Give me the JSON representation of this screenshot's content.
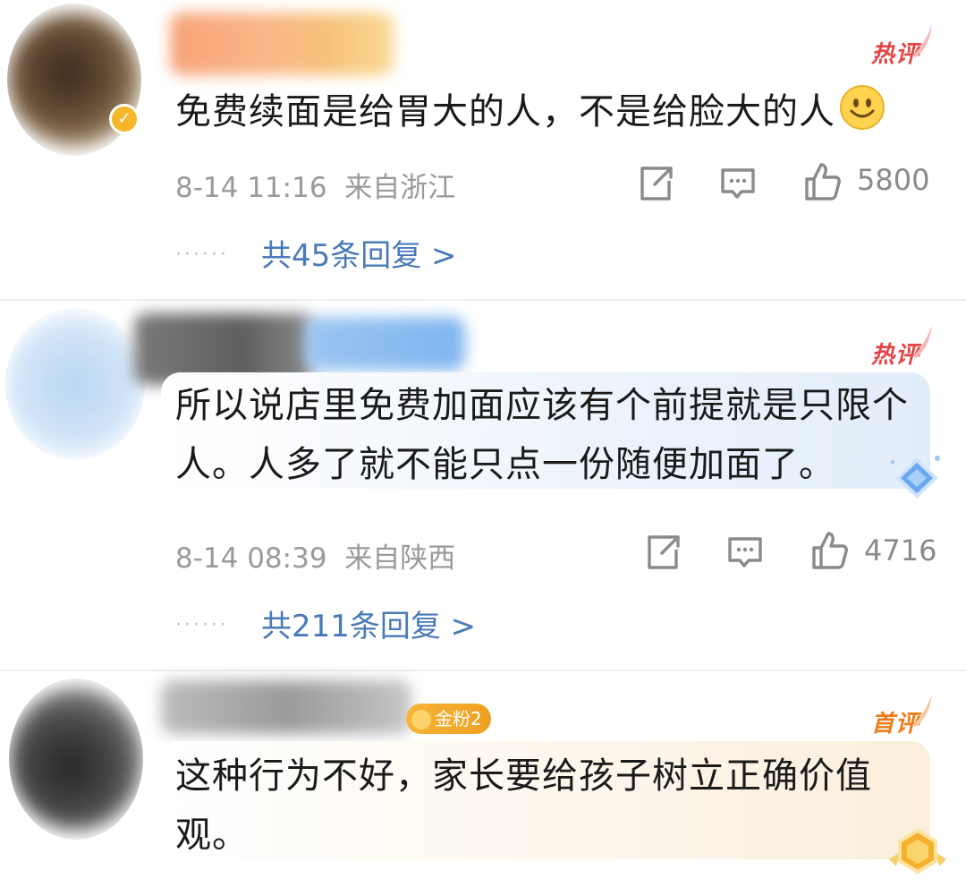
{
  "colors": {
    "link_blue": "#4a7ab8",
    "hot_tag_red": "#e34545",
    "first_tag_orange": "#f07a14",
    "meta_gray": "#9a9a9a",
    "fan_badge_gold": "#f0a020"
  },
  "comments": [
    {
      "tag": "热评",
      "text": "免费续面是给胃大的人，不是给脸大的人",
      "emoji": "smile-emoji",
      "time": "8-14 11:16",
      "location": "来自浙江",
      "likes": "5800",
      "replies": "共45条回复 >",
      "verified": true
    },
    {
      "tag": "热评",
      "text_line1": "所以说店里免费加面应该有个前提就是只限个",
      "text_line2": "人。人多了就不能只点一份随便加面了。",
      "time": "8-14 08:39",
      "location": "来自陕西",
      "likes": "4716",
      "replies": "共211条回复 >"
    },
    {
      "tag": "首评",
      "fan_badge": "金粉2",
      "text_line1": "这种行为不好，家长要给孩子树立正确价值",
      "text_line2": "观。"
    }
  ],
  "icons": [
    "repost-icon",
    "comment-icon",
    "like-icon",
    "verified-icon",
    "diamond-badge-icon",
    "gold-medal-badge-icon"
  ]
}
